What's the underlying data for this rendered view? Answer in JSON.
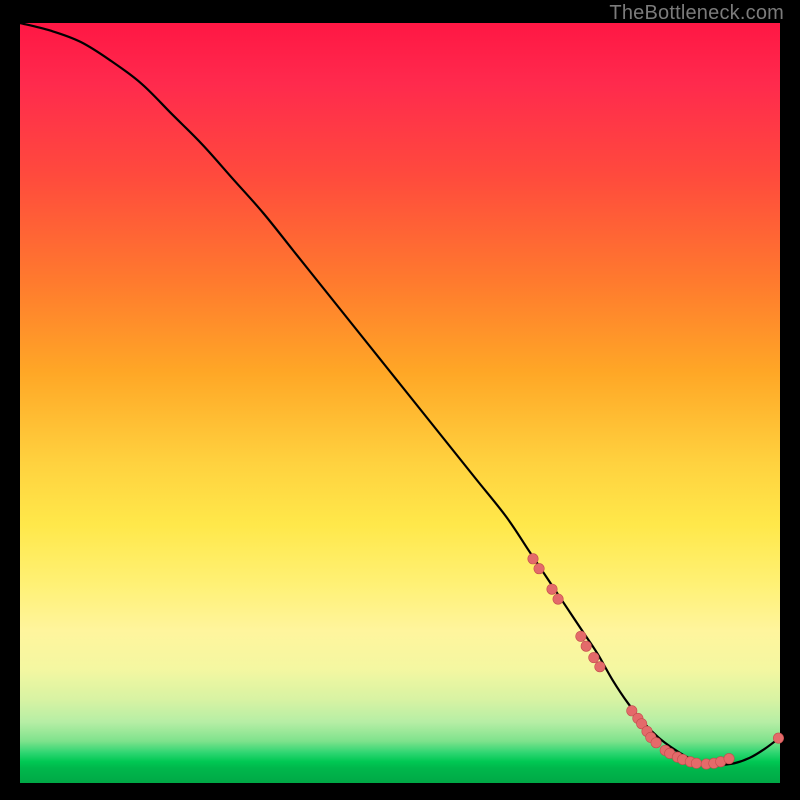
{
  "attribution": "TheBottleneck.com",
  "colors": {
    "background": "#000000",
    "gradient_top": "#ff1744",
    "gradient_mid_upper": "#ffa726",
    "gradient_mid": "#fff176",
    "gradient_bottom": "#00c853",
    "curve": "#000000",
    "marker_fill": "#e46a6a",
    "marker_stroke": "#c44d4d"
  },
  "chart_data": {
    "type": "line",
    "title": "",
    "xlabel": "",
    "ylabel": "",
    "xlim": [
      0,
      100
    ],
    "ylim": [
      0,
      100
    ],
    "grid": false,
    "legend": false,
    "series": [
      {
        "name": "bottleneck-curve",
        "x": [
          0,
          4,
          8,
          12,
          16,
          20,
          24,
          28,
          32,
          36,
          40,
          44,
          48,
          52,
          56,
          60,
          64,
          67,
          70,
          72,
          74,
          76,
          78,
          80,
          82,
          84,
          86,
          88,
          90,
          92,
          94,
          96,
          98,
          100
        ],
        "y": [
          100,
          99,
          97.5,
          95,
          92,
          88,
          84,
          79.5,
          75,
          70,
          65,
          60,
          55,
          50,
          45,
          40,
          35,
          30.5,
          26,
          23,
          20,
          17,
          13.5,
          10.5,
          8,
          6,
          4.5,
          3.3,
          2.6,
          2.4,
          2.6,
          3.3,
          4.5,
          6
        ]
      }
    ],
    "markers": [
      {
        "x": 67.5,
        "y": 29.5
      },
      {
        "x": 68.3,
        "y": 28.2
      },
      {
        "x": 70.0,
        "y": 25.5
      },
      {
        "x": 70.8,
        "y": 24.2
      },
      {
        "x": 73.8,
        "y": 19.3
      },
      {
        "x": 74.5,
        "y": 18.0
      },
      {
        "x": 75.5,
        "y": 16.5
      },
      {
        "x": 76.3,
        "y": 15.3
      },
      {
        "x": 80.5,
        "y": 9.5
      },
      {
        "x": 81.3,
        "y": 8.5
      },
      {
        "x": 81.8,
        "y": 7.8
      },
      {
        "x": 82.5,
        "y": 6.8
      },
      {
        "x": 83.0,
        "y": 6.0
      },
      {
        "x": 83.7,
        "y": 5.3
      },
      {
        "x": 84.9,
        "y": 4.3
      },
      {
        "x": 85.5,
        "y": 3.9
      },
      {
        "x": 86.5,
        "y": 3.4
      },
      {
        "x": 87.2,
        "y": 3.1
      },
      {
        "x": 88.2,
        "y": 2.8
      },
      {
        "x": 89.0,
        "y": 2.6
      },
      {
        "x": 90.3,
        "y": 2.5
      },
      {
        "x": 91.3,
        "y": 2.6
      },
      {
        "x": 92.2,
        "y": 2.8
      },
      {
        "x": 93.3,
        "y": 3.2
      },
      {
        "x": 99.8,
        "y": 5.9
      }
    ],
    "marker_radius_px": 5.2
  }
}
